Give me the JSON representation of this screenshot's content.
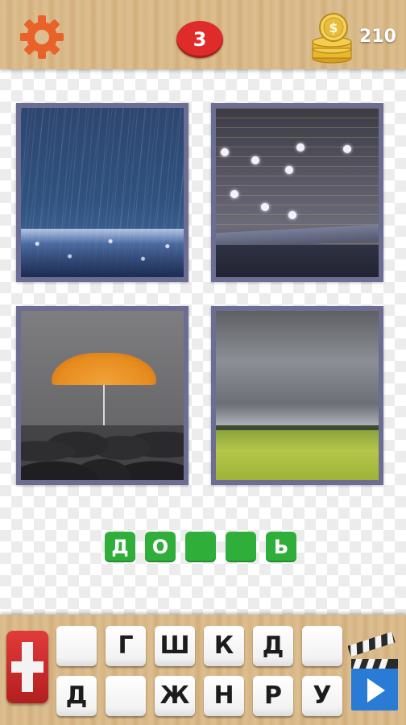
{
  "header": {
    "settings_icon": "gear-icon",
    "level": "3",
    "coins_icon": "coin-stack-icon",
    "coins": "210"
  },
  "pictures": [
    {
      "name": "picture-1"
    },
    {
      "name": "picture-2"
    },
    {
      "name": "picture-3"
    },
    {
      "name": "picture-4"
    }
  ],
  "answer": {
    "slots": [
      "Д",
      "О",
      "",
      "",
      "Ь"
    ]
  },
  "keyboard": {
    "row1": [
      "",
      "Г",
      "Ш",
      "К",
      "Д",
      ""
    ],
    "row2": [
      "Д",
      "",
      "Ж",
      "Н",
      "Р",
      "У"
    ],
    "hint_icon": "plus-icon",
    "video_icon": "clapperboard-play-icon"
  },
  "colors": {
    "level_badge": "#e02b2b",
    "answer_slot": "#2fae3a",
    "gear": "#e8622a",
    "hint_button": "#d22c2c",
    "video_button": "#2a7bd6",
    "tile_frame": "#6c6d93"
  }
}
